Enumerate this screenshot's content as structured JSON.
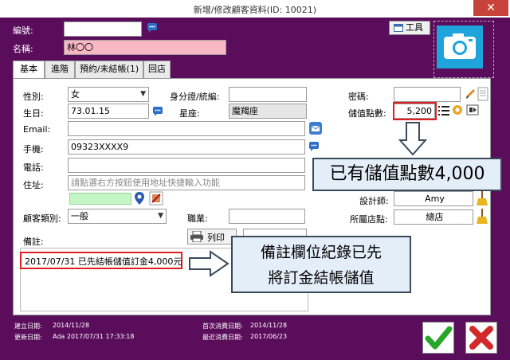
{
  "title": "新增/修改顧客資料(ID: 10021)",
  "close_label": "✕",
  "header": {
    "number_label": "編號:",
    "number_value": "",
    "name_label": "名稱:",
    "name_value": "林〇〇",
    "tool_label": "工具"
  },
  "tabs": [
    "基本",
    "進階",
    "預約/未結帳(1)",
    "回店"
  ],
  "form": {
    "gender_label": "性別:",
    "gender_value": "女",
    "birthday_label": "生日:",
    "birthday_value": "73.01.15",
    "email_label": "Email:",
    "email_value": "",
    "mobile_label": "手機:",
    "mobile_value": "09323XXXX9",
    "phone_label": "電話:",
    "phone_value": "",
    "address_label": "住址:",
    "address_placeholder": "請點選右方按鈕使用地址快捷輸入功能",
    "customer_type_label": "顧客類別:",
    "customer_type_value": "一般",
    "job_label": "職業:",
    "job_value": "",
    "id_label": "身分證/統編:",
    "id_value": "",
    "zodiac_label": "星座:",
    "zodiac_value": "魔羯座",
    "password_label": "密碼:",
    "password_value": "",
    "stored_points_label": "儲值點數:",
    "stored_points_value": "5,200",
    "designer_label": "設計師:",
    "designer_value": "Amy",
    "store_label": "所屬店點:",
    "store_value": "總店",
    "note_label": "備註:",
    "print_label": "列印",
    "note_value": "2017/07/31 已先結帳儲值訂金4,000元"
  },
  "callouts": {
    "points": "已有儲值點數4,000",
    "note": "備註欄位紀錄已先\n將訂金結帳儲值"
  },
  "footer": {
    "created_label": "建立日期:",
    "created_value": "2014/11/28",
    "updated_label": "更新日期:",
    "updated_value": "Ada 2017/07/31 17:33:18",
    "first_visit_label": "首次消費日期:",
    "first_visit_value": "2014/11/28",
    "last_visit_label": "最近消費日期:",
    "last_visit_value": "2017/06/23"
  },
  "colors": {
    "window_bg": "#5a0d5a",
    "highlight_red": "#e02020",
    "name_pink": "#f7b8c4",
    "camera_blue": "#1ea3db"
  }
}
